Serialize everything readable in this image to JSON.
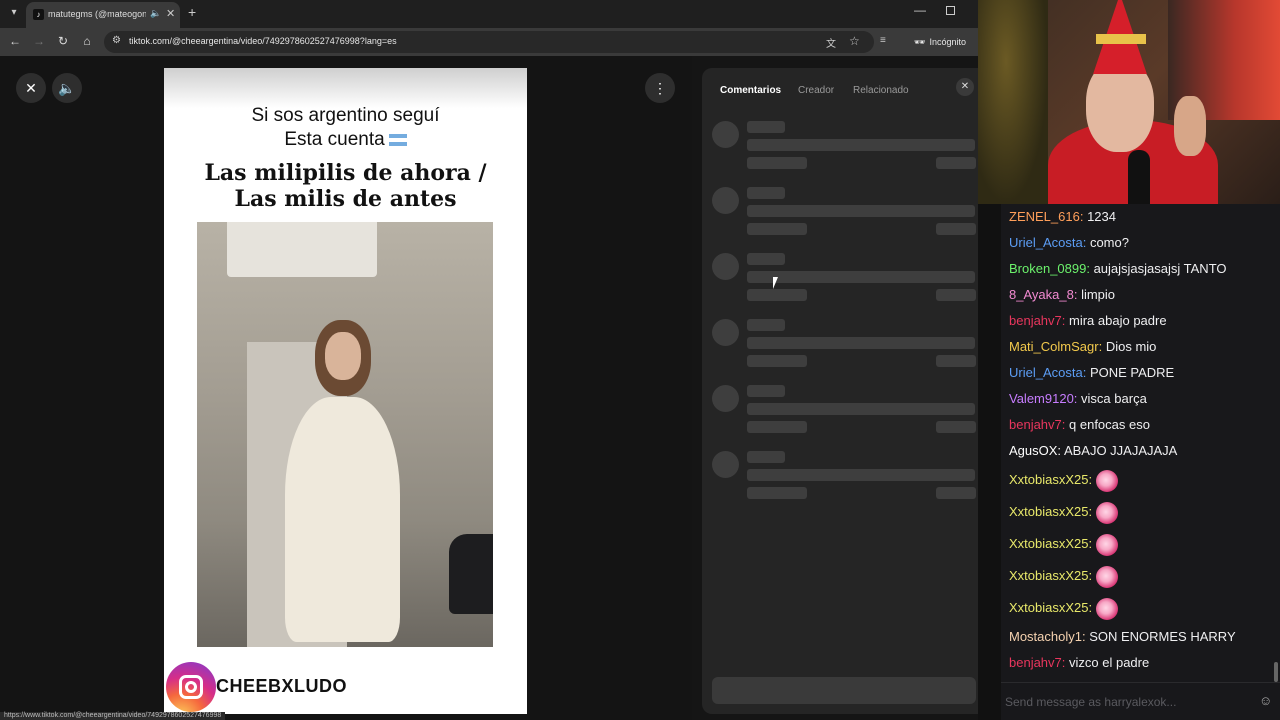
{
  "browser": {
    "tab_title": "matutegms (@mateogonzalez)",
    "url": "tiktok.com/@cheeargentina/video/7492978602527476998?lang=es",
    "incognito_label": "Incógnito",
    "status_url": "https://www.tiktok.com/@cheeargentina/video/7492978602527476998"
  },
  "video": {
    "top_text_line1": "Si sos argentino seguí",
    "top_text_line2": "Esta cuenta",
    "headline_line1": "Las milipilis de ahora /",
    "headline_line2": "Las milis de antes",
    "handle": "CHEEBXLUDO"
  },
  "comments_panel": {
    "tabs": [
      "Comentarios",
      "Creador",
      "Relacionado"
    ],
    "active_tab": "Comentarios"
  },
  "chat": {
    "messages": [
      {
        "user": "ZENEL_616:",
        "text": "1234",
        "color": "#ff9f5a",
        "emote": false
      },
      {
        "user": "Uriel_Acosta:",
        "text": "como?",
        "color": "#5c9df5",
        "emote": false
      },
      {
        "user": "Broken_0899:",
        "text": "aujajsjasjasajsj TANTO",
        "color": "#6cf26c",
        "emote": false
      },
      {
        "user": "8_Ayaka_8:",
        "text": "limpio",
        "color": "#f28ad1",
        "emote": false
      },
      {
        "user": "benjahv7:",
        "text": "mira abajo padre",
        "color": "#e8365d",
        "emote": false
      },
      {
        "user": "Mati_ColmSagr:",
        "text": "Dios mio",
        "color": "#f2c94c",
        "emote": false
      },
      {
        "user": "Uriel_Acosta:",
        "text": "PONE PADRE",
        "color": "#5c9df5",
        "emote": false
      },
      {
        "user": "Valem9120:",
        "text": "visca barça",
        "color": "#c77dff",
        "emote": false
      },
      {
        "user": "benjahv7:",
        "text": "q enfocas eso",
        "color": "#e8365d",
        "emote": false
      },
      {
        "user": "AgusOX:",
        "text": "ABAJO JJAJAJAJA",
        "color": "#ffffff",
        "emote": false
      },
      {
        "user": "XxtobiasxX25:",
        "text": "",
        "color": "#e8e86a",
        "emote": true
      },
      {
        "user": "XxtobiasxX25:",
        "text": "",
        "color": "#e8e86a",
        "emote": true
      },
      {
        "user": "XxtobiasxX25:",
        "text": "",
        "color": "#e8e86a",
        "emote": true
      },
      {
        "user": "XxtobiasxX25:",
        "text": "",
        "color": "#e8e86a",
        "emote": true
      },
      {
        "user": "XxtobiasxX25:",
        "text": "",
        "color": "#e8e86a",
        "emote": true
      },
      {
        "user": "Mostacholy1:",
        "text": "SON ENORMES HARRY",
        "color": "#f5d2b0",
        "emote": false
      },
      {
        "user": "benjahv7:",
        "text": "vizco el padre",
        "color": "#e8365d",
        "emote": false
      }
    ],
    "input_placeholder": "Send message as harryalexok..."
  }
}
